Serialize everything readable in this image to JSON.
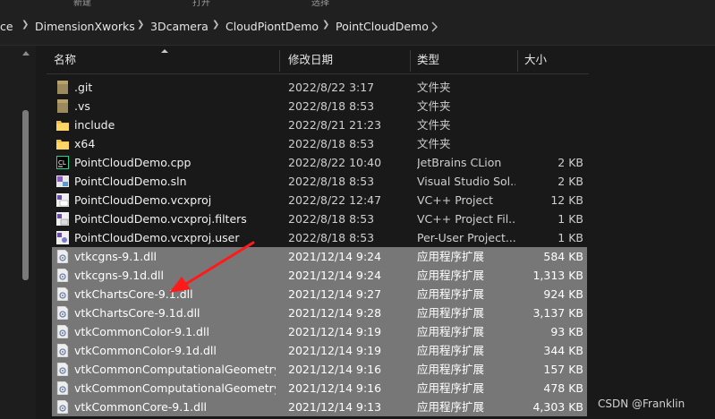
{
  "toolbar": {
    "partial_labels": [
      "新建",
      "打开",
      "选择"
    ]
  },
  "breadcrumb": {
    "items": [
      "ce",
      "DimensionXworks",
      "3Dcamera",
      "CloudPiontDemo",
      "PointCloudDemo"
    ]
  },
  "columns": {
    "name": "名称",
    "date": "修改日期",
    "type": "类型",
    "size": "大小"
  },
  "files": [
    {
      "name": ".git",
      "date": "2022/8/22 3:17",
      "type": "文件夹",
      "size": "",
      "icon": "folder-dim-icon",
      "selected": false
    },
    {
      "name": ".vs",
      "date": "2022/8/18 8:53",
      "type": "文件夹",
      "size": "",
      "icon": "folder-dim-icon",
      "selected": false
    },
    {
      "name": "include",
      "date": "2022/8/21 21:23",
      "type": "文件夹",
      "size": "",
      "icon": "folder-icon",
      "selected": false
    },
    {
      "name": "x64",
      "date": "2022/8/18 8:53",
      "type": "文件夹",
      "size": "",
      "icon": "folder-icon",
      "selected": false
    },
    {
      "name": "PointCloudDemo.cpp",
      "date": "2022/8/22 10:40",
      "type": "JetBrains CLion",
      "size": "2 KB",
      "icon": "clion-icon",
      "selected": false
    },
    {
      "name": "PointCloudDemo.sln",
      "date": "2022/8/18 8:53",
      "type": "Visual Studio Sol...",
      "size": "2 KB",
      "icon": "vs-solution-icon",
      "selected": false
    },
    {
      "name": "PointCloudDemo.vcxproj",
      "date": "2022/8/22 12:47",
      "type": "VC++ Project",
      "size": "12 KB",
      "icon": "vcxproj-icon",
      "selected": false
    },
    {
      "name": "PointCloudDemo.vcxproj.filters",
      "date": "2022/8/18 8:53",
      "type": "VC++ Project Fil...",
      "size": "1 KB",
      "icon": "vcxproj-filters-icon",
      "selected": false
    },
    {
      "name": "PointCloudDemo.vcxproj.user",
      "date": "2022/8/18 8:53",
      "type": "Per-User Project...",
      "size": "1 KB",
      "icon": "vcxproj-user-icon",
      "selected": false
    },
    {
      "name": "vtkcgns-9.1.dll",
      "date": "2021/12/14 9:24",
      "type": "应用程序扩展",
      "size": "584 KB",
      "icon": "dll-icon",
      "selected": true
    },
    {
      "name": "vtkcgns-9.1d.dll",
      "date": "2021/12/14 9:24",
      "type": "应用程序扩展",
      "size": "1,313 KB",
      "icon": "dll-icon",
      "selected": true
    },
    {
      "name": "vtkChartsCore-9.1.dll",
      "date": "2021/12/14 9:27",
      "type": "应用程序扩展",
      "size": "924 KB",
      "icon": "dll-icon",
      "selected": true
    },
    {
      "name": "vtkChartsCore-9.1d.dll",
      "date": "2021/12/14 9:28",
      "type": "应用程序扩展",
      "size": "3,137 KB",
      "icon": "dll-icon",
      "selected": true
    },
    {
      "name": "vtkCommonColor-9.1.dll",
      "date": "2021/12/14 9:19",
      "type": "应用程序扩展",
      "size": "93 KB",
      "icon": "dll-icon",
      "selected": true
    },
    {
      "name": "vtkCommonColor-9.1d.dll",
      "date": "2021/12/14 9:19",
      "type": "应用程序扩展",
      "size": "344 KB",
      "icon": "dll-icon",
      "selected": true
    },
    {
      "name": "vtkCommonComputationalGeometry-...",
      "date": "2021/12/14 9:16",
      "type": "应用程序扩展",
      "size": "157 KB",
      "icon": "dll-icon",
      "selected": true
    },
    {
      "name": "vtkCommonComputationalGeometry-...",
      "date": "2021/12/14 9:16",
      "type": "应用程序扩展",
      "size": "478 KB",
      "icon": "dll-icon",
      "selected": true
    },
    {
      "name": "vtkCommonCore-9.1.dll",
      "date": "2021/12/14 9:13",
      "type": "应用程序扩展",
      "size": "4,303 KB",
      "icon": "dll-icon",
      "selected": true
    }
  ],
  "watermark": "CSDN @Franklin",
  "colors": {
    "selection": "#777777",
    "background": "#191919",
    "arrow": "#ff1a1a",
    "folder": "#f0c24b"
  }
}
